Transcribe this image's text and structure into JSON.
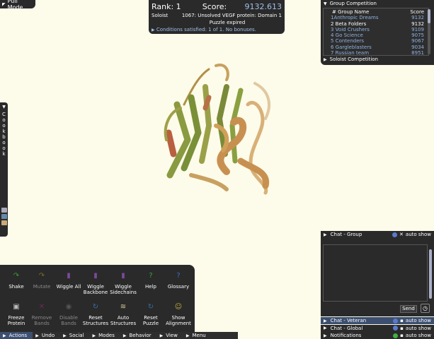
{
  "pull_mode": {
    "label": "Pull Mode"
  },
  "rank_panel": {
    "rank_label": "Rank: 1",
    "score_label": "Score:",
    "score_value": "9132.613",
    "mode": "Soloist",
    "puzzle": "1067: Unsolved VEGF protein: Domain 1",
    "status": "Puzzle expired",
    "conditions": "Conditions satisfied: 1 of 1. No bonuses."
  },
  "group_competition": {
    "title": "Group Competition",
    "header": {
      "name": "# Group Name",
      "score": "Score"
    },
    "rows": [
      {
        "name": "1Anthropic Dreams",
        "score": "9132",
        "highlight": false
      },
      {
        "name": "2 Beta Folders",
        "score": "9132",
        "highlight": true
      },
      {
        "name": "3 Void Crushers",
        "score": "9109",
        "highlight": false
      },
      {
        "name": "4 Go Science",
        "score": "9075",
        "highlight": false
      },
      {
        "name": "5 Contenders",
        "score": "9067",
        "highlight": false
      },
      {
        "name": "6 Gargleblasters",
        "score": "9034",
        "highlight": false
      },
      {
        "name": "7 Russian team",
        "score": "8951",
        "highlight": false
      }
    ],
    "soloist_label": "Soloist Competition"
  },
  "cookbook": {
    "letters": [
      "C",
      "o",
      "o",
      "k",
      "b",
      "o",
      "o",
      "k"
    ]
  },
  "tools": {
    "row1": [
      {
        "label": "Shake",
        "icon": "shake-icon",
        "glyph": "↷",
        "color": "#3a9a3a",
        "dim": false
      },
      {
        "label": "Mutate",
        "icon": "mutate-icon",
        "glyph": "↷",
        "color": "#7a6a30",
        "dim": true
      },
      {
        "label": "Wiggle All",
        "icon": "wiggle-all-icon",
        "glyph": "▮",
        "color": "#7a4a9a",
        "dim": false
      },
      {
        "label": "Wiggle Backbone",
        "icon": "wiggle-backbone-icon",
        "glyph": "▮",
        "color": "#7a4a9a",
        "dim": false
      },
      {
        "label": "Wiggle Sidechains",
        "icon": "wiggle-sidechains-icon",
        "glyph": "▮",
        "color": "#7a4a9a",
        "dim": false
      },
      {
        "label": "Help",
        "icon": "help-icon",
        "glyph": "?",
        "color": "#3aa040",
        "dim": false
      },
      {
        "label": "Glossary",
        "icon": "glossary-icon",
        "glyph": "?",
        "color": "#3a70c0",
        "dim": false
      }
    ],
    "row2": [
      {
        "label": "Freeze Protein",
        "icon": "freeze-icon",
        "glyph": "▣",
        "color": "#bbbbbb",
        "dim": false
      },
      {
        "label": "Remove Bands",
        "icon": "remove-bands-icon",
        "glyph": "✕",
        "color": "#6a2a5a",
        "dim": true
      },
      {
        "label": "Disable Bands",
        "icon": "disable-bands-icon",
        "glyph": "◉",
        "color": "#555555",
        "dim": true
      },
      {
        "label": "Reset Structures",
        "icon": "reset-structures-icon",
        "glyph": "↻",
        "color": "#3a6aa0",
        "dim": false
      },
      {
        "label": "Auto Structures",
        "icon": "auto-structures-icon",
        "glyph": "≋",
        "color": "#d8c890",
        "dim": false
      },
      {
        "label": "Reset Puzzle",
        "icon": "reset-puzzle-icon",
        "glyph": "↻",
        "color": "#3a6aa0",
        "dim": false
      },
      {
        "label": "Show Alignment",
        "icon": "show-alignment-icon",
        "glyph": "☺",
        "color": "#c0b040",
        "dim": false
      }
    ]
  },
  "bottom_tabs": [
    "Actions",
    "Undo",
    "Social",
    "Modes",
    "Behavior",
    "View",
    "Menu"
  ],
  "chat": {
    "group_title": "Chat - Group",
    "auto_show": "auto show",
    "send_label": "Send",
    "rows": [
      {
        "title": "Chat - Veteran",
        "dot": "#5a7ad0",
        "sel": true
      },
      {
        "title": "Chat - Global",
        "dot": "#5a7ad0",
        "sel": false
      },
      {
        "title": "Notifications",
        "dot": "#40b040",
        "sel": false
      }
    ]
  },
  "colors": {
    "background": "#fdfbe9",
    "panel": "#2a2a2a",
    "accent_blue": "#9fc0e8"
  }
}
